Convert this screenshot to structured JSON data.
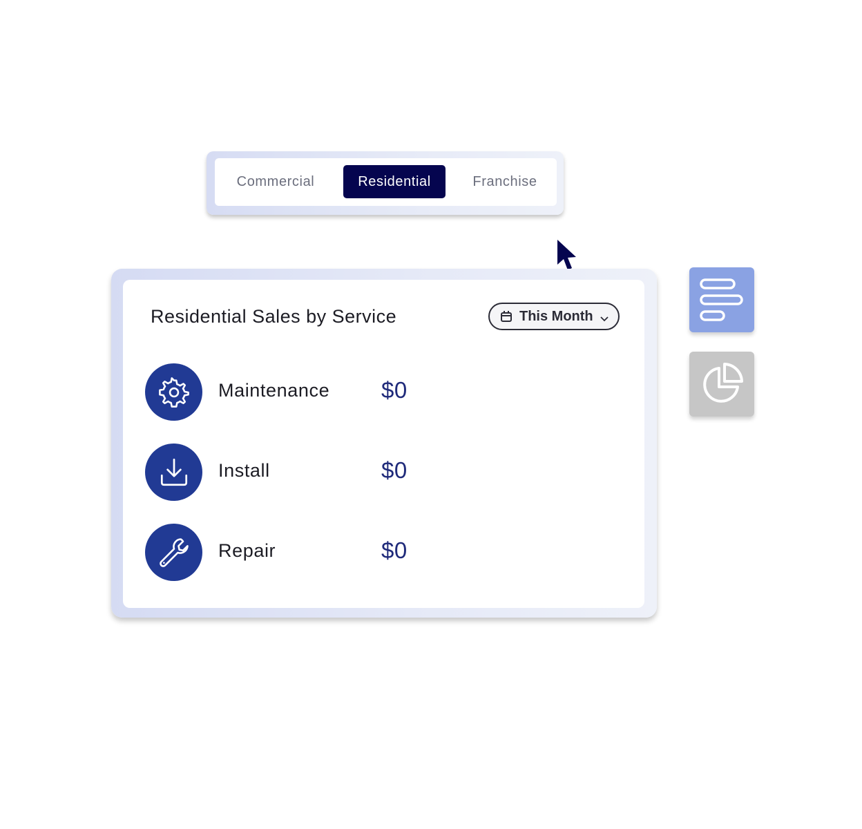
{
  "tabs": {
    "items": [
      {
        "label": "Commercial",
        "selected": false
      },
      {
        "label": "Residential",
        "selected": true
      },
      {
        "label": "Franchise",
        "selected": false
      }
    ]
  },
  "card": {
    "title": "Residential Sales by Service",
    "period": {
      "label": "This Month",
      "icon": "calendar-icon",
      "chevron": "chevron-down-icon"
    },
    "rows": [
      {
        "label": "Maintenance",
        "value": "$0",
        "icon": "gear-icon"
      },
      {
        "label": "Install",
        "value": "$0",
        "icon": "download-icon"
      },
      {
        "label": "Repair",
        "value": "$0",
        "icon": "wrench-icon"
      }
    ]
  },
  "view_toggles": [
    {
      "icon": "bar-chart-icon",
      "active": true
    },
    {
      "icon": "pie-chart-icon",
      "active": false
    }
  ],
  "colors": {
    "accent_dark": "#05054f",
    "icon_circle": "#213a94",
    "value_text": "#1f2a7a",
    "toggle_active": "#8aa2e3",
    "toggle_inactive": "#c6c6c6"
  }
}
